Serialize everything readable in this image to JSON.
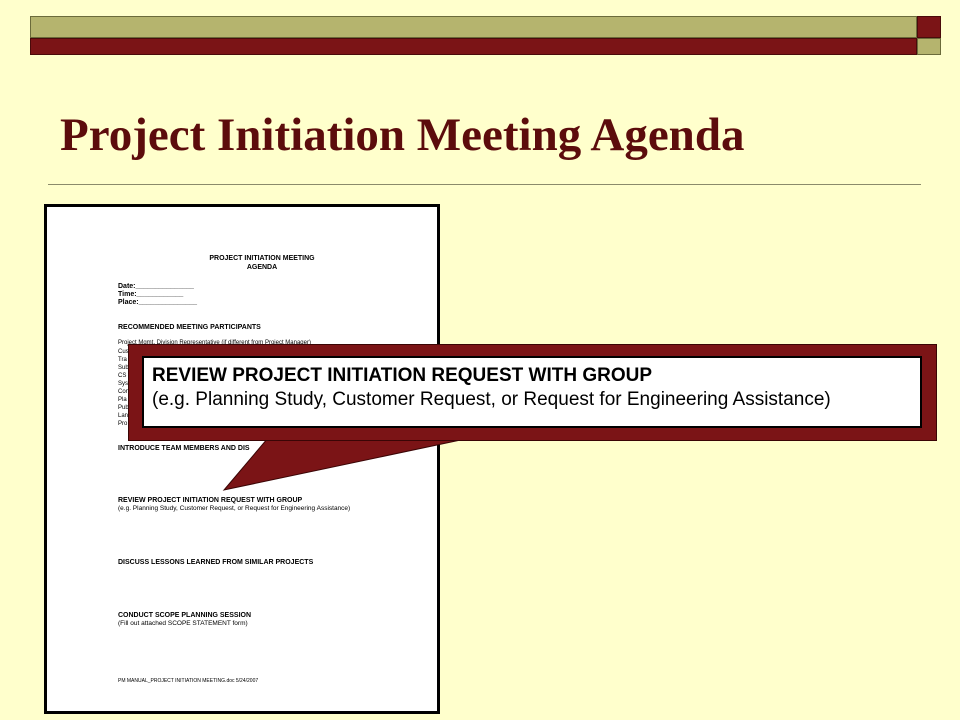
{
  "slide": {
    "title": "Project Initiation Meeting Agenda"
  },
  "document": {
    "heading_line1": "PROJECT INITIATION MEETING",
    "heading_line2": "AGENDA",
    "date_label": "Date:_______________",
    "time_label": "Time:____________",
    "place_label": "Place:_______________",
    "participants_heading": "RECOMMENDED MEETING PARTICIPANTS",
    "participant_line1": "Project Mgmt. Division Representative (if different from Project Manager)",
    "participant_fragments": [
      "Cus",
      "Tra",
      "Sub",
      "CS",
      "Sys",
      "Con",
      "Pla",
      "Pub",
      "Lan",
      "Pro"
    ],
    "introduce_heading": "INTRODUCE TEAM MEMBERS AND DIS",
    "review_heading": "REVIEW PROJECT INITIATION REQUEST WITH GROUP",
    "review_sub": "(e.g. Planning Study, Customer Request, or Request for Engineering  Assistance)",
    "lessons_heading": "DISCUSS LESSONS LEARNED FROM SIMILAR PROJECTS",
    "scope_heading": "CONDUCT SCOPE PLANNING SESSION",
    "scope_sub": "(Fill out attached SCOPE STATEMENT form)",
    "footer": "PM MANUAL_PROJECT INITIATION MEETING.doc 5/24/2007"
  },
  "callout": {
    "heading": "REVIEW PROJECT INITIATION REQUEST WITH GROUP",
    "subtext": "(e.g. Planning Study, Customer Request, or Request for Engineering  Assistance)"
  },
  "colors": {
    "background": "#ffffcc",
    "maroon": "#7b1416",
    "olive": "#b5b46e",
    "title": "#5c0c0c"
  }
}
